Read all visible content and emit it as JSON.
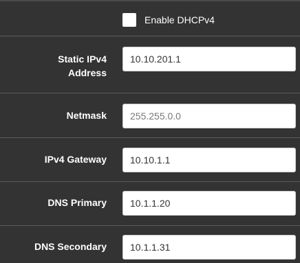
{
  "dhcp": {
    "label": "Enable DHCPv4",
    "checked": false
  },
  "fields": [
    {
      "label_line1": "Static IPv4",
      "label_line2": "Address",
      "value": "10.10.201.1"
    },
    {
      "label": "Netmask",
      "value": "255.255.0.0"
    },
    {
      "label": "IPv4 Gateway",
      "value": "10.10.1.1"
    },
    {
      "label": "DNS Primary",
      "value": "10.1.1.20"
    },
    {
      "label": "DNS Secondary",
      "value": "10.1.1.31"
    }
  ]
}
